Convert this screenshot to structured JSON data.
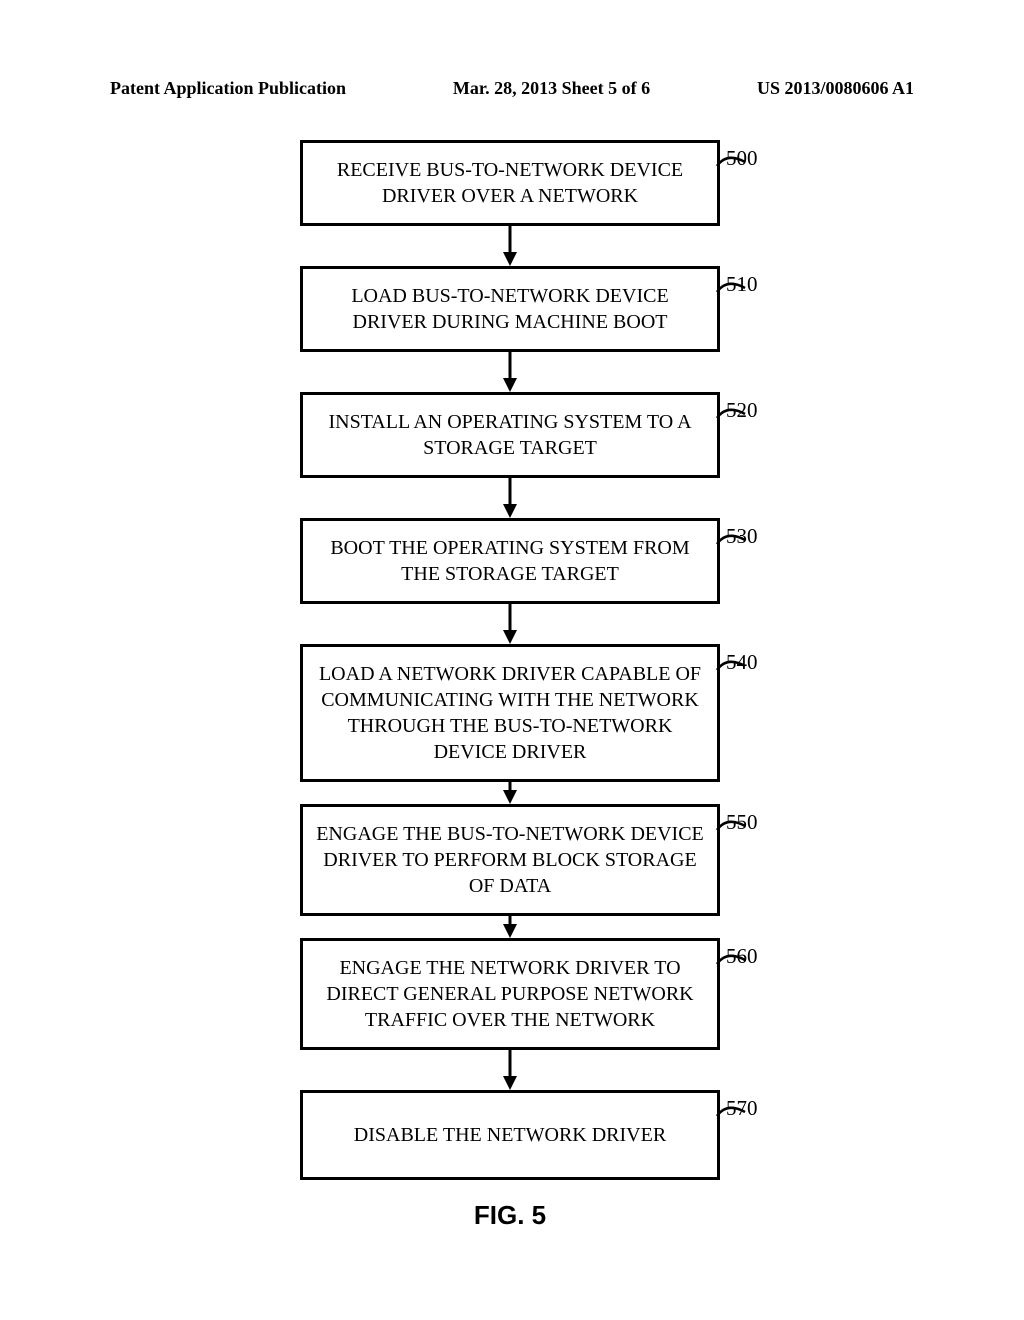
{
  "header": {
    "left": "Patent Application Publication",
    "center": "Mar. 28, 2013  Sheet 5 of 6",
    "right": "US 2013/0080606 A1"
  },
  "steps": [
    {
      "ref": "500",
      "text": "RECEIVE BUS-TO-NETWORK DEVICE DRIVER OVER A NETWORK"
    },
    {
      "ref": "510",
      "text": "LOAD BUS-TO-NETWORK DEVICE DRIVER DURING MACHINE BOOT"
    },
    {
      "ref": "520",
      "text": "INSTALL AN OPERATING SYSTEM TO A STORAGE TARGET"
    },
    {
      "ref": "530",
      "text": "BOOT THE OPERATING SYSTEM FROM THE STORAGE TARGET"
    },
    {
      "ref": "540",
      "text": "LOAD A NETWORK DRIVER CAPABLE OF COMMUNICATING WITH THE NETWORK THROUGH THE BUS-TO-NETWORK DEVICE DRIVER"
    },
    {
      "ref": "550",
      "text": "ENGAGE THE BUS-TO-NETWORK DEVICE DRIVER TO PERFORM BLOCK STORAGE OF DATA"
    },
    {
      "ref": "560",
      "text": "ENGAGE THE NETWORK DRIVER TO DIRECT GENERAL PURPOSE NETWORK TRAFFIC OVER THE NETWORK"
    },
    {
      "ref": "570",
      "text": "DISABLE THE NETWORK DRIVER"
    }
  ],
  "figure_label": "FIG. 5"
}
